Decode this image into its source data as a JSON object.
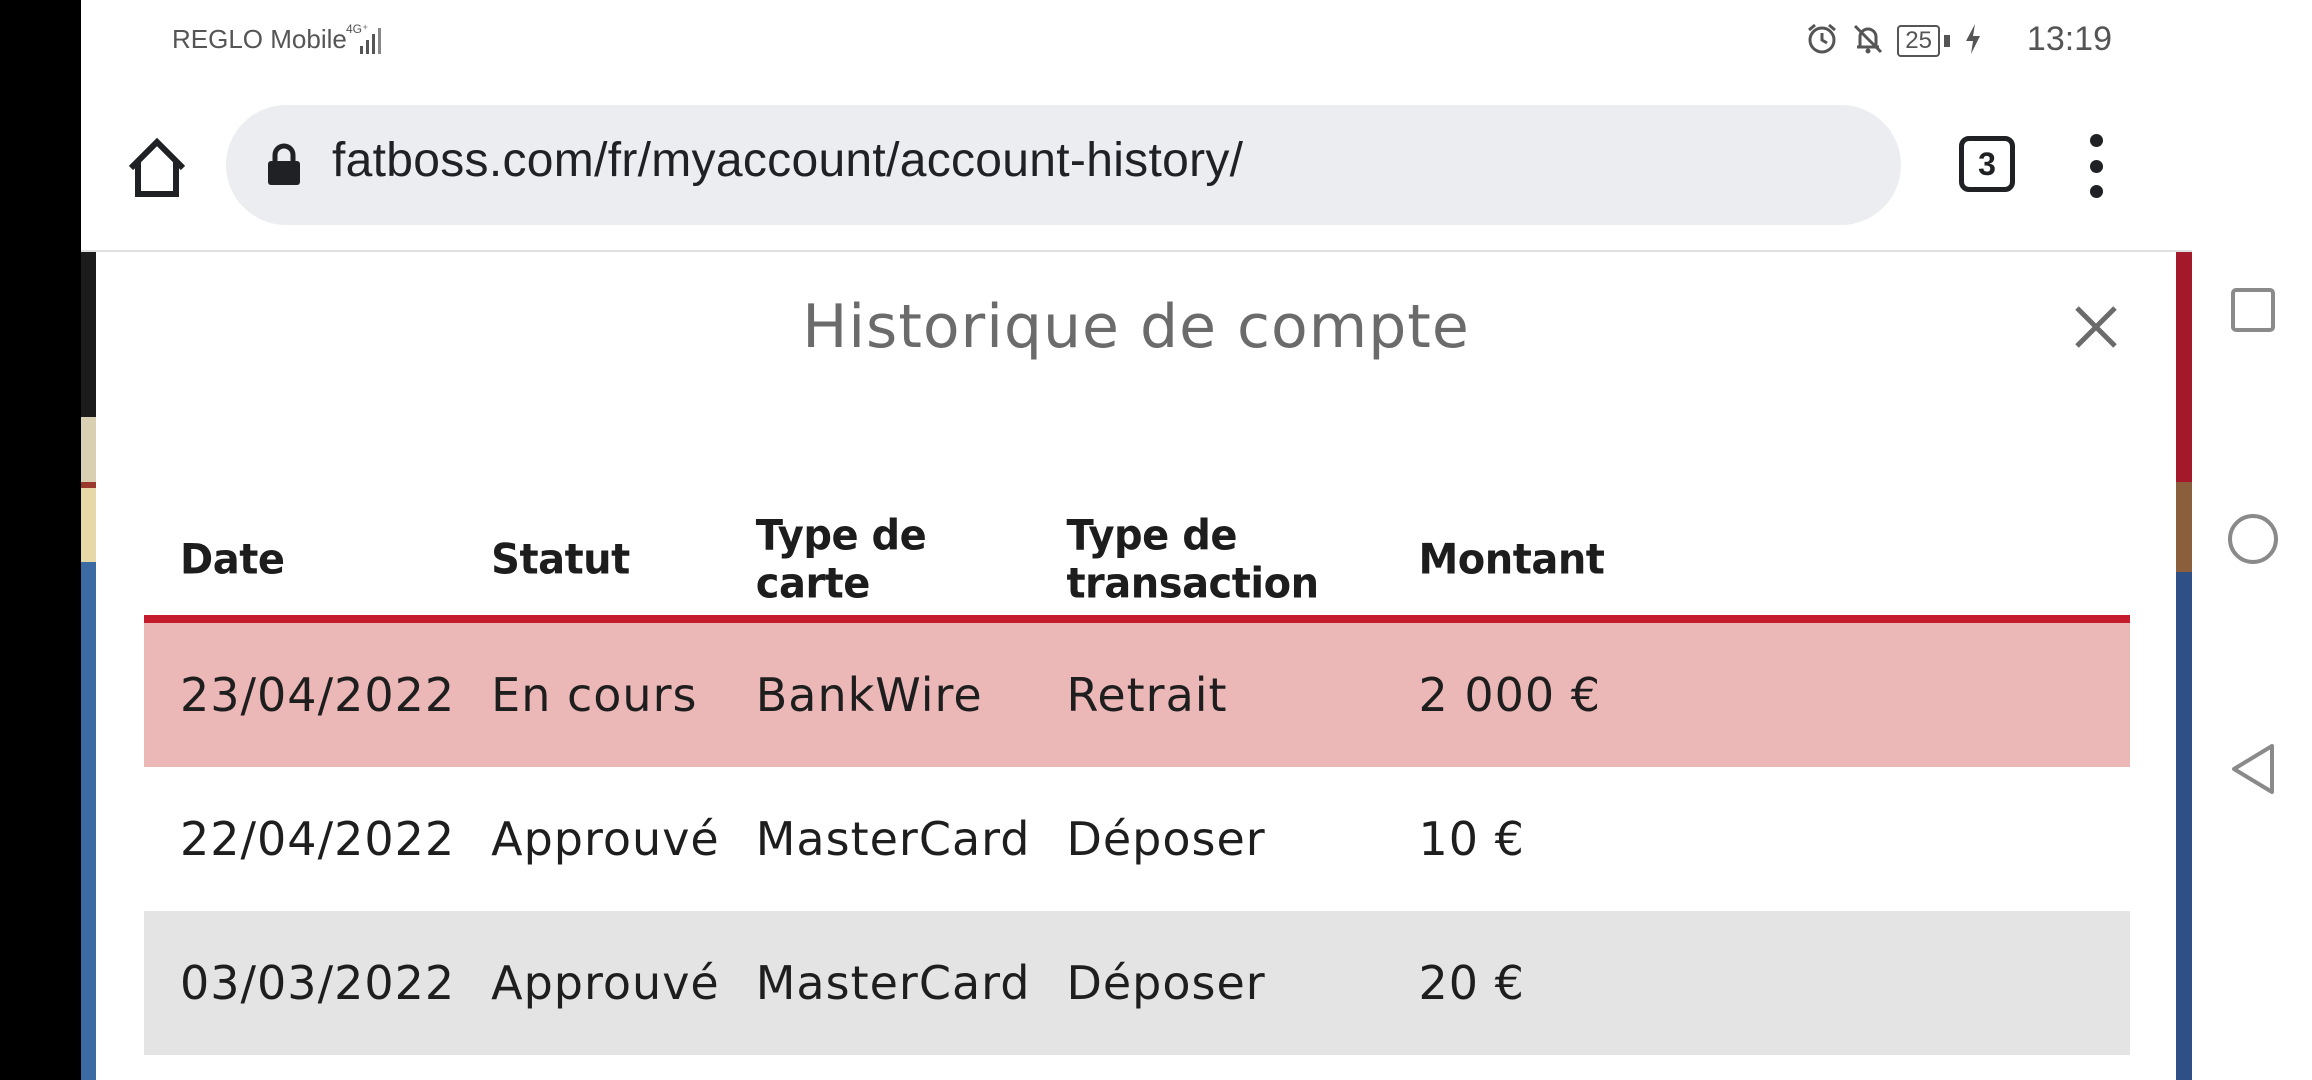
{
  "status_bar": {
    "carrier": "REGLO Mobile",
    "network": "4G⁺",
    "battery": "25",
    "time": "13:19"
  },
  "browser": {
    "url": "fatboss.com/fr/myaccount/account-history/",
    "tab_count": "3"
  },
  "modal": {
    "title": "Historique de compte",
    "table": {
      "headers": [
        "Date",
        "Statut",
        "Type de carte",
        "Type de transaction",
        "Montant"
      ],
      "rows": [
        {
          "date": "23/04/2022",
          "status": "En cours",
          "card": "BankWire",
          "type": "Retrait",
          "amount": "2 000 €",
          "highlight": "pending"
        },
        {
          "date": "22/04/2022",
          "status": "Approuvé",
          "card": "MasterCard",
          "type": "Déposer",
          "amount": "10 €",
          "highlight": "none"
        },
        {
          "date": "03/03/2022",
          "status": "Approuvé",
          "card": "MasterCard",
          "type": "Déposer",
          "amount": "20 €",
          "highlight": "alt"
        }
      ]
    }
  },
  "colors": {
    "accent_red": "#c41b2d",
    "pending_row": "#ebb7b7",
    "alt_row": "#e4e4e4"
  },
  "icons": [
    "home-icon",
    "lock-icon",
    "tabs-icon",
    "more-vert-icon",
    "close-icon",
    "alarm-icon",
    "bell-off-icon",
    "battery-icon",
    "charging-icon",
    "signal-icon",
    "nav-square-icon",
    "nav-circle-icon",
    "nav-back-icon"
  ]
}
